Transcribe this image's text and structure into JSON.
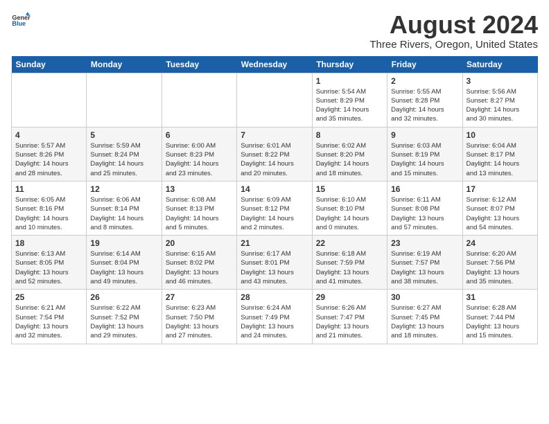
{
  "logo": {
    "line1": "General",
    "line2": "Blue"
  },
  "title": "August 2024",
  "subtitle": "Three Rivers, Oregon, United States",
  "days_of_week": [
    "Sunday",
    "Monday",
    "Tuesday",
    "Wednesday",
    "Thursday",
    "Friday",
    "Saturday"
  ],
  "weeks": [
    [
      {
        "day": "",
        "info": ""
      },
      {
        "day": "",
        "info": ""
      },
      {
        "day": "",
        "info": ""
      },
      {
        "day": "",
        "info": ""
      },
      {
        "day": "1",
        "info": "Sunrise: 5:54 AM\nSunset: 8:29 PM\nDaylight: 14 hours\nand 35 minutes."
      },
      {
        "day": "2",
        "info": "Sunrise: 5:55 AM\nSunset: 8:28 PM\nDaylight: 14 hours\nand 32 minutes."
      },
      {
        "day": "3",
        "info": "Sunrise: 5:56 AM\nSunset: 8:27 PM\nDaylight: 14 hours\nand 30 minutes."
      }
    ],
    [
      {
        "day": "4",
        "info": "Sunrise: 5:57 AM\nSunset: 8:26 PM\nDaylight: 14 hours\nand 28 minutes."
      },
      {
        "day": "5",
        "info": "Sunrise: 5:59 AM\nSunset: 8:24 PM\nDaylight: 14 hours\nand 25 minutes."
      },
      {
        "day": "6",
        "info": "Sunrise: 6:00 AM\nSunset: 8:23 PM\nDaylight: 14 hours\nand 23 minutes."
      },
      {
        "day": "7",
        "info": "Sunrise: 6:01 AM\nSunset: 8:22 PM\nDaylight: 14 hours\nand 20 minutes."
      },
      {
        "day": "8",
        "info": "Sunrise: 6:02 AM\nSunset: 8:20 PM\nDaylight: 14 hours\nand 18 minutes."
      },
      {
        "day": "9",
        "info": "Sunrise: 6:03 AM\nSunset: 8:19 PM\nDaylight: 14 hours\nand 15 minutes."
      },
      {
        "day": "10",
        "info": "Sunrise: 6:04 AM\nSunset: 8:17 PM\nDaylight: 14 hours\nand 13 minutes."
      }
    ],
    [
      {
        "day": "11",
        "info": "Sunrise: 6:05 AM\nSunset: 8:16 PM\nDaylight: 14 hours\nand 10 minutes."
      },
      {
        "day": "12",
        "info": "Sunrise: 6:06 AM\nSunset: 8:14 PM\nDaylight: 14 hours\nand 8 minutes."
      },
      {
        "day": "13",
        "info": "Sunrise: 6:08 AM\nSunset: 8:13 PM\nDaylight: 14 hours\nand 5 minutes."
      },
      {
        "day": "14",
        "info": "Sunrise: 6:09 AM\nSunset: 8:12 PM\nDaylight: 14 hours\nand 2 minutes."
      },
      {
        "day": "15",
        "info": "Sunrise: 6:10 AM\nSunset: 8:10 PM\nDaylight: 14 hours\nand 0 minutes."
      },
      {
        "day": "16",
        "info": "Sunrise: 6:11 AM\nSunset: 8:08 PM\nDaylight: 13 hours\nand 57 minutes."
      },
      {
        "day": "17",
        "info": "Sunrise: 6:12 AM\nSunset: 8:07 PM\nDaylight: 13 hours\nand 54 minutes."
      }
    ],
    [
      {
        "day": "18",
        "info": "Sunrise: 6:13 AM\nSunset: 8:05 PM\nDaylight: 13 hours\nand 52 minutes."
      },
      {
        "day": "19",
        "info": "Sunrise: 6:14 AM\nSunset: 8:04 PM\nDaylight: 13 hours\nand 49 minutes."
      },
      {
        "day": "20",
        "info": "Sunrise: 6:15 AM\nSunset: 8:02 PM\nDaylight: 13 hours\nand 46 minutes."
      },
      {
        "day": "21",
        "info": "Sunrise: 6:17 AM\nSunset: 8:01 PM\nDaylight: 13 hours\nand 43 minutes."
      },
      {
        "day": "22",
        "info": "Sunrise: 6:18 AM\nSunset: 7:59 PM\nDaylight: 13 hours\nand 41 minutes."
      },
      {
        "day": "23",
        "info": "Sunrise: 6:19 AM\nSunset: 7:57 PM\nDaylight: 13 hours\nand 38 minutes."
      },
      {
        "day": "24",
        "info": "Sunrise: 6:20 AM\nSunset: 7:56 PM\nDaylight: 13 hours\nand 35 minutes."
      }
    ],
    [
      {
        "day": "25",
        "info": "Sunrise: 6:21 AM\nSunset: 7:54 PM\nDaylight: 13 hours\nand 32 minutes."
      },
      {
        "day": "26",
        "info": "Sunrise: 6:22 AM\nSunset: 7:52 PM\nDaylight: 13 hours\nand 29 minutes."
      },
      {
        "day": "27",
        "info": "Sunrise: 6:23 AM\nSunset: 7:50 PM\nDaylight: 13 hours\nand 27 minutes."
      },
      {
        "day": "28",
        "info": "Sunrise: 6:24 AM\nSunset: 7:49 PM\nDaylight: 13 hours\nand 24 minutes."
      },
      {
        "day": "29",
        "info": "Sunrise: 6:26 AM\nSunset: 7:47 PM\nDaylight: 13 hours\nand 21 minutes."
      },
      {
        "day": "30",
        "info": "Sunrise: 6:27 AM\nSunset: 7:45 PM\nDaylight: 13 hours\nand 18 minutes."
      },
      {
        "day": "31",
        "info": "Sunrise: 6:28 AM\nSunset: 7:44 PM\nDaylight: 13 hours\nand 15 minutes."
      }
    ]
  ]
}
